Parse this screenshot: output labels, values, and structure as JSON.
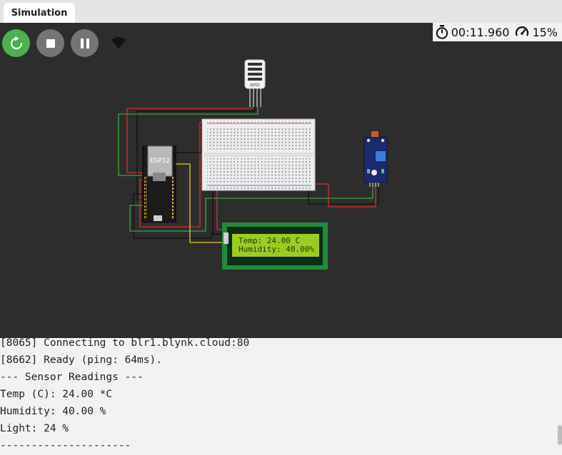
{
  "tab": {
    "label": "Simulation"
  },
  "stats": {
    "timer": "00:11.960",
    "cpu": "15%"
  },
  "controls": {
    "restart": "restart-icon",
    "stop": "stop-icon",
    "pause": "pause-icon",
    "wifi": "wifi-icon"
  },
  "parts": {
    "dht_label": "DHT22",
    "esp32_label": "ESP32",
    "lcd_line1": "Temp: 24.00 C",
    "lcd_line2": "Humidity: 40.00%"
  },
  "colors": {
    "canvas": "#2d2d2d",
    "restart": "#4caf50",
    "lcd_screen": "#9ccc23",
    "lcd_board": "#1e8c3a"
  },
  "console": {
    "lines": [
      "[8065] Connecting to blr1.blynk.cloud:80",
      "[8662] Ready (ping: 64ms).",
      "--- Sensor Readings ---",
      "Temp (C): 24.00 *C",
      "Humidity: 40.00 %",
      "Light: 24 %",
      "---------------------"
    ]
  }
}
